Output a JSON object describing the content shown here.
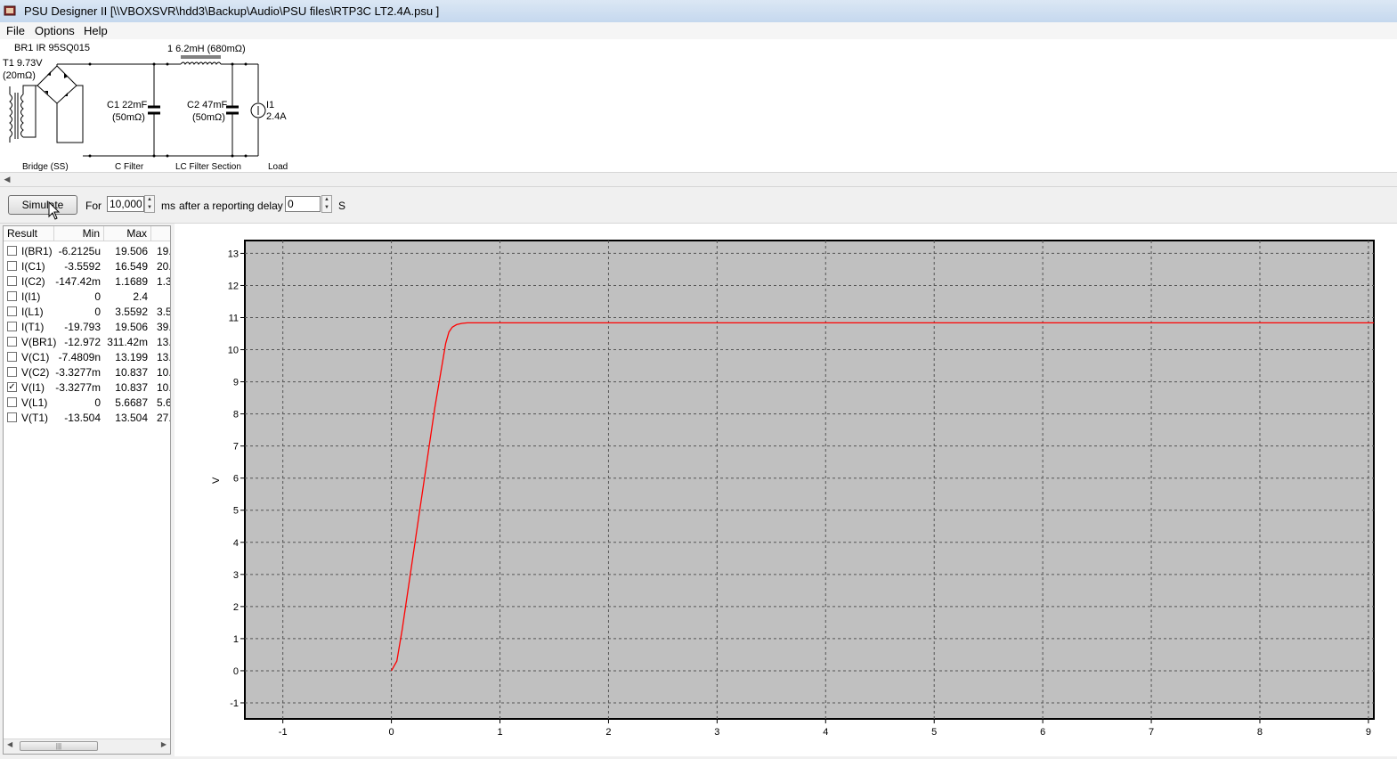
{
  "window": {
    "title": "PSU Designer II  [\\\\VBOXSVR\\hdd3\\Backup\\Audio\\PSU files\\RTP3C LT2.4A.psu ]"
  },
  "menu": [
    "File",
    "Options",
    "Help"
  ],
  "circuit": {
    "t1_name": "T1 9.73V",
    "t1_res": "(20mΩ)",
    "br1": "BR1 IR  95SQ015",
    "l1": "1 6.2mH (680mΩ)",
    "c1_name": "C1 22mF",
    "c1_res": "(50mΩ)",
    "c2_name": "C2 47mF",
    "c2_res": "(50mΩ)",
    "i1_name": "I1",
    "i1_val": "2.4A",
    "sections": [
      "Bridge (SS)",
      "C Filter",
      "LC Filter Section",
      "Load"
    ]
  },
  "toolbar": {
    "simulate": "Simulate",
    "for_label": "For",
    "duration": "10,000",
    "ms_label": "ms",
    "delay_label": "after a reporting delay of",
    "delay": "0",
    "s_label": "S"
  },
  "results": {
    "headers": [
      "Result",
      "Min",
      "Max"
    ],
    "rows": [
      {
        "name": "I(BR1)",
        "min": "-6.2125u",
        "max": "19.506",
        "extra": "19.",
        "checked": false
      },
      {
        "name": "I(C1)",
        "min": "-3.5592",
        "max": "16.549",
        "extra": "20.",
        "checked": false
      },
      {
        "name": "I(C2)",
        "min": "-147.42m",
        "max": "1.1689",
        "extra": "1.3",
        "checked": false
      },
      {
        "name": "I(I1)",
        "min": "0",
        "max": "2.4",
        "extra": "",
        "checked": false
      },
      {
        "name": "I(L1)",
        "min": "0",
        "max": "3.5592",
        "extra": "3.5",
        "checked": false
      },
      {
        "name": "I(T1)",
        "min": "-19.793",
        "max": "19.506",
        "extra": "39.",
        "checked": false
      },
      {
        "name": "V(BR1)",
        "min": "-12.972",
        "max": "311.42m",
        "extra": "13.",
        "checked": false
      },
      {
        "name": "V(C1)",
        "min": "-7.4809n",
        "max": "13.199",
        "extra": "13.",
        "checked": false
      },
      {
        "name": "V(C2)",
        "min": "-3.3277m",
        "max": "10.837",
        "extra": "10.",
        "checked": false
      },
      {
        "name": "V(I1)",
        "min": "-3.3277m",
        "max": "10.837",
        "extra": "10.",
        "checked": true
      },
      {
        "name": "V(L1)",
        "min": "0",
        "max": "5.6687",
        "extra": "5.6",
        "checked": false
      },
      {
        "name": "V(T1)",
        "min": "-13.504",
        "max": "13.504",
        "extra": "27.",
        "checked": false
      }
    ]
  },
  "chart_data": {
    "type": "line",
    "ylabel": "V",
    "xlim": [
      -1.35,
      9.05
    ],
    "ylim": [
      -1.5,
      13.4
    ],
    "xticks": [
      -1,
      0,
      1,
      2,
      3,
      4,
      5,
      6,
      7,
      8,
      9
    ],
    "yticks": [
      -1,
      0,
      1,
      2,
      3,
      4,
      5,
      6,
      7,
      8,
      9,
      10,
      11,
      12,
      13
    ],
    "grid": true,
    "series": [
      {
        "color": "#ff0000",
        "x": [
          0,
          0.05,
          0.1,
          0.2,
          0.3,
          0.4,
          0.5,
          0.53,
          0.56,
          0.6,
          0.65,
          0.7,
          0.8,
          1.0,
          3,
          6,
          9.05
        ],
        "y": [
          0,
          0.3,
          1.3,
          3.6,
          5.9,
          8.2,
          10.2,
          10.55,
          10.7,
          10.78,
          10.82,
          10.835,
          10.837,
          10.837,
          10.837,
          10.837,
          10.837
        ]
      }
    ]
  }
}
